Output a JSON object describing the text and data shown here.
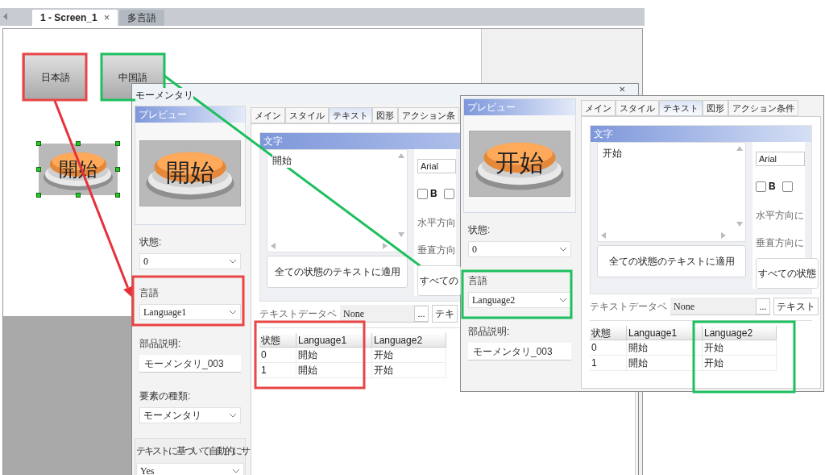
{
  "editor": {
    "tabs": [
      {
        "label": "1 - Screen_1",
        "close": "×",
        "selected": true
      },
      {
        "label": "多言語",
        "selected": false
      }
    ],
    "canvas_buttons": [
      {
        "label": "日本語"
      },
      {
        "label": "中国語"
      }
    ],
    "canvas_part": {
      "label": "開始",
      "selected": true
    }
  },
  "dialogs": [
    {
      "title": "モーメンタリ",
      "close": "×",
      "preview_title": "プレビュー",
      "preview_text": "開始",
      "tabs": [
        {
          "label": "メイン",
          "selected": false
        },
        {
          "label": "スタイル",
          "selected": false
        },
        {
          "label": "テキスト",
          "selected": true
        },
        {
          "label": "図形",
          "selected": false
        },
        {
          "label": "アクション条",
          "selected": false
        }
      ],
      "section": "文字",
      "text_value": "開始",
      "font": "Arial",
      "checkboxes": [
        {
          "label": "B",
          "checked": false
        },
        {
          "checked": false
        }
      ],
      "h_align": "水平方向",
      "v_align": "垂直方向",
      "apply_button": "全ての状態のテキストに適用",
      "apply_all_button": "すべての",
      "db_label": "テキストデータベ",
      "db_value": "None",
      "db_button": "...",
      "text_button": "テキ",
      "fields": [
        {
          "kind": "select",
          "label": "状態:",
          "value": "0"
        },
        {
          "kind": "select",
          "label": "言語",
          "value": "Language1"
        },
        {
          "kind": "text",
          "label": "部品説明:",
          "value": "モーメンタリ_003"
        },
        {
          "kind": "select",
          "label": "要素の種類:",
          "value": "モーメンタリ"
        },
        {
          "kind": "panel",
          "label": "テキストに基づいて自動的にサ",
          "value": "Yes"
        }
      ],
      "table": {
        "columns": [
          "状態",
          "Language1",
          "Language2"
        ],
        "rows": [
          [
            "0",
            "開始",
            "开始"
          ],
          [
            "1",
            "開始",
            "开始"
          ]
        ]
      }
    },
    {
      "preview_title": "プレビュー",
      "preview_text": "开始",
      "tabs": [
        {
          "label": "メイン",
          "selected": false
        },
        {
          "label": "スタイル",
          "selected": false
        },
        {
          "label": "テキスト",
          "selected": true
        },
        {
          "label": "図形",
          "selected": false
        },
        {
          "label": "アクション条件",
          "selected": false
        }
      ],
      "section": "文字",
      "text_value": "开始",
      "font": "Arial",
      "checkboxes": [
        {
          "label": "B",
          "checked": false
        },
        {
          "checked": false
        }
      ],
      "h_align": "水平方向に",
      "v_align": "垂直方向に",
      "apply_button": "全ての状態のテキストに適用",
      "apply_all_button": "すべての状態",
      "db_label": "テキストデータベ",
      "db_value": "None",
      "db_button": "...",
      "text_button": "テキスト",
      "fields": [
        {
          "kind": "select",
          "label": "状態:",
          "value": "0"
        },
        {
          "kind": "select",
          "label": "言語",
          "value": "Language2"
        },
        {
          "kind": "text",
          "label": "部品説明:",
          "value": "モーメンタリ_003"
        }
      ],
      "table": {
        "columns": [
          "状態",
          "Language1",
          "Language2"
        ],
        "rows": [
          [
            "0",
            "開始",
            "开始"
          ],
          [
            "1",
            "開始",
            "开始"
          ]
        ]
      }
    }
  ],
  "annotations": {
    "boxes": [
      {
        "color": "#e84545"
      },
      {
        "color": "#1dbf5e"
      },
      {
        "color": "#e84545"
      },
      {
        "color": "#e84545"
      },
      {
        "color": "#1dbf5e"
      },
      {
        "color": "#1dbf5e"
      }
    ],
    "arrows": [
      {
        "color": "#e8303a"
      },
      {
        "color": "#1dbf5e"
      }
    ]
  }
}
